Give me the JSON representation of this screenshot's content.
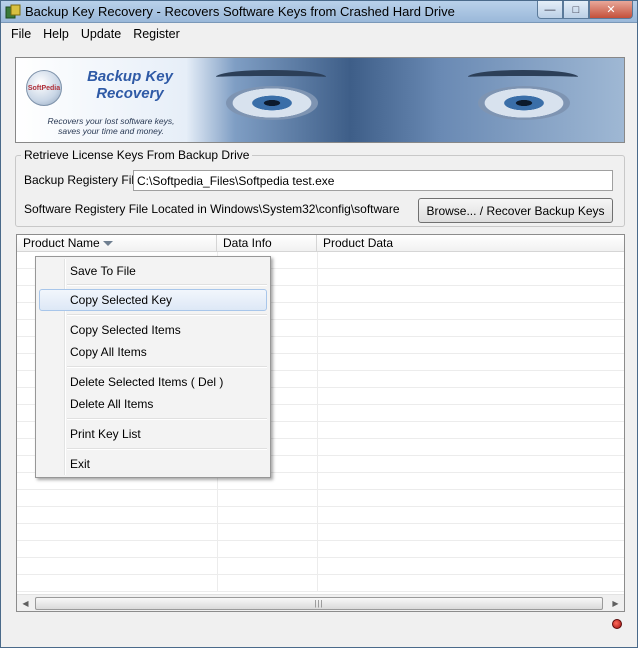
{
  "window": {
    "title": "Backup Key Recovery - Recovers Software Keys from Crashed Hard Drive",
    "buttons": {
      "minimize": "—",
      "maximize": "□",
      "close": "✕"
    }
  },
  "menubar": {
    "items": [
      {
        "label": "File"
      },
      {
        "label": "Help"
      },
      {
        "label": "Update"
      },
      {
        "label": "Register"
      }
    ]
  },
  "banner": {
    "title_line1": "Backup Key",
    "title_line2": "Recovery",
    "subtitle_line1": "Recovers your lost software keys,",
    "subtitle_line2": "saves your time and money.",
    "logo_text": "SoftPedia"
  },
  "retrieve": {
    "group_label": "Retrieve License Keys From Backup Drive",
    "registry_file_label": "Backup Registery File:",
    "registry_file_value": "C:\\Softpedia_Files\\Softpedia test.exe",
    "location_text": "Software Registery File Located in Windows\\System32\\config\\software",
    "browse_button": "Browse... / Recover Backup Keys"
  },
  "list": {
    "columns": [
      "Product Name",
      "Data Info",
      "Product Data"
    ],
    "rows": []
  },
  "context_menu": {
    "items": [
      {
        "label": "Save To File"
      },
      {
        "label": "Copy Selected Key",
        "highlighted": true
      },
      {
        "label": "Copy Selected Items"
      },
      {
        "label": "Copy All Items"
      },
      {
        "label": "Delete Selected Items ( Del )"
      },
      {
        "label": "Delete All Items"
      },
      {
        "label": "Print Key List"
      },
      {
        "label": "Exit"
      }
    ]
  },
  "colors": {
    "highlight_border": "#a8c6ea",
    "status_indicator": "#c01818"
  }
}
